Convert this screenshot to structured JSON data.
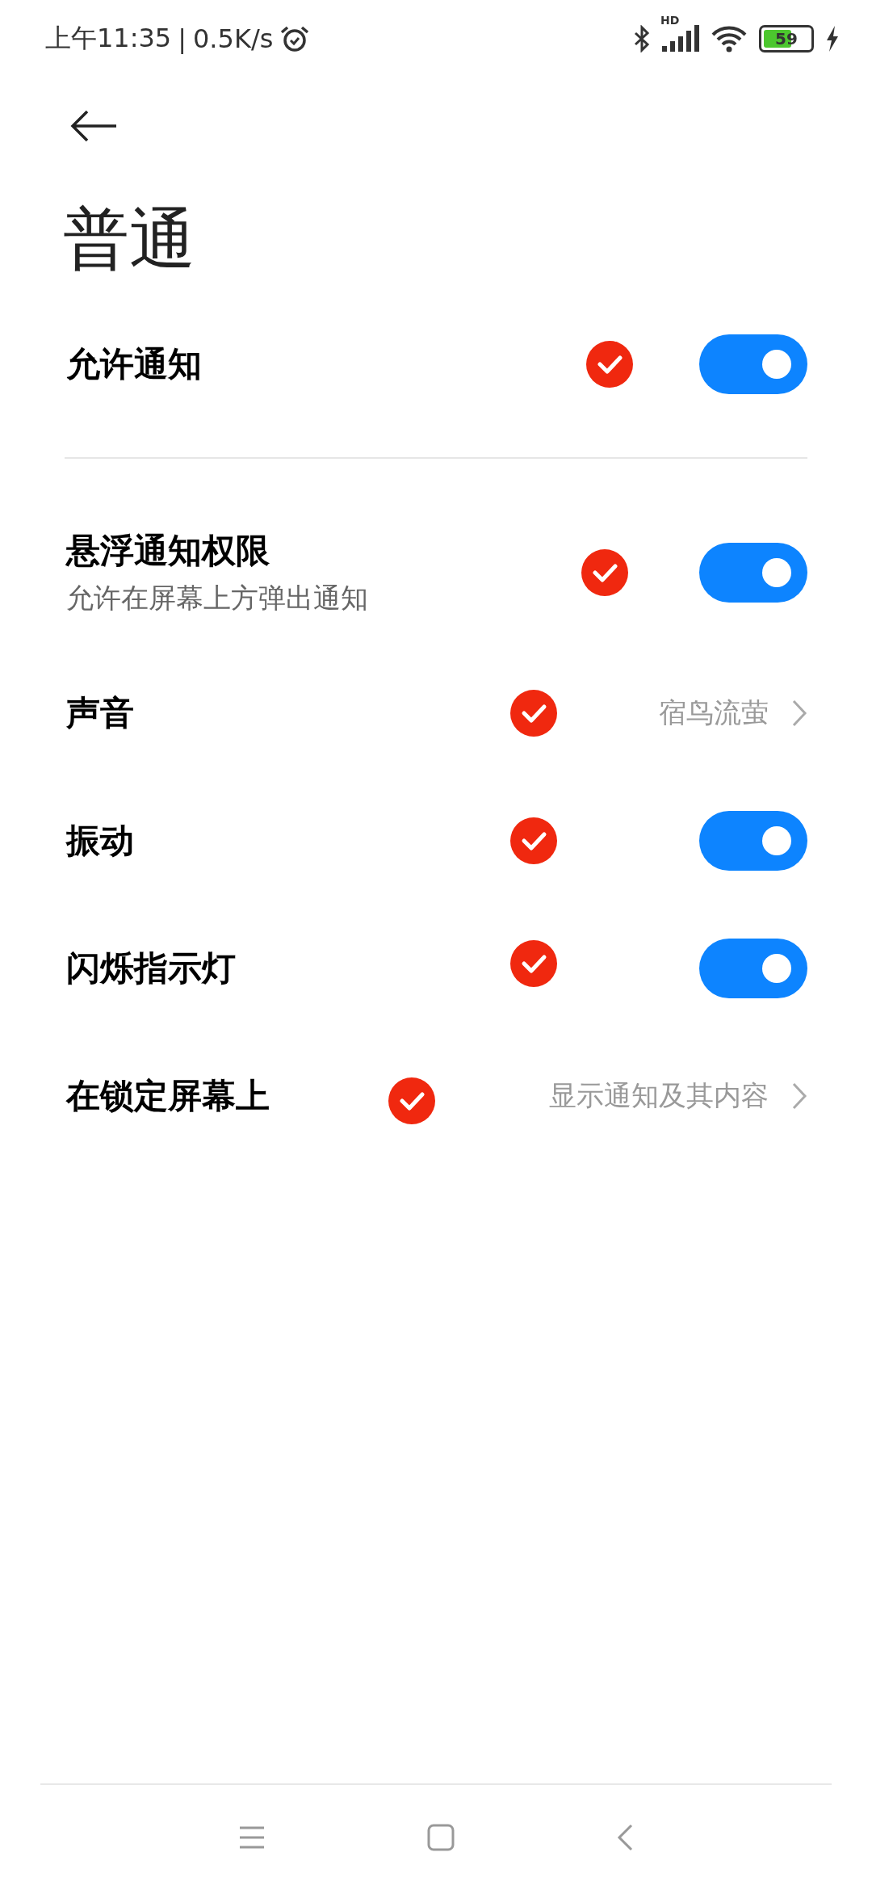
{
  "status_bar": {
    "time": "上午11:35",
    "separator": "|",
    "speed": "0.5K/s",
    "network": "HD",
    "battery": "59"
  },
  "title": "普通",
  "sections": [
    {
      "items": [
        {
          "kind": "toggle",
          "label": "允许通知",
          "on": true
        }
      ]
    },
    {
      "items": [
        {
          "kind": "toggle",
          "label": "悬浮通知权限",
          "subtitle": "允许在屏幕上方弹出通知",
          "on": true
        },
        {
          "kind": "link",
          "label": "声音",
          "value": "宿鸟流萤"
        },
        {
          "kind": "toggle",
          "label": "振动",
          "on": true
        },
        {
          "kind": "toggle",
          "label": "闪烁指示灯",
          "on": true
        },
        {
          "kind": "link",
          "label": "在锁定屏幕上",
          "value": "显示通知及其内容"
        }
      ]
    }
  ]
}
